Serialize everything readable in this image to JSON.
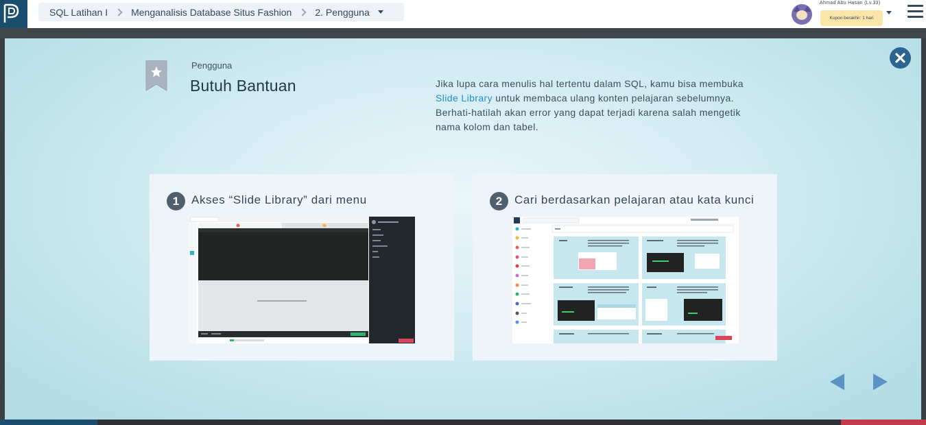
{
  "header": {
    "breadcrumb": [
      "SQL Latihan I",
      "Menganalisis Database Situs Fashion",
      "2. Pengguna"
    ],
    "user_name": "Ahmad Abu Hasan (Lv.33)",
    "coupon": "Kupon berakhir: 1 hari"
  },
  "slide": {
    "kicker": "Pengguna",
    "title": "Butuh Bantuan",
    "intro_before": "Jika lupa cara menulis hal tertentu dalam SQL, kamu bisa membuka ",
    "intro_link": "Slide Library",
    "intro_after": " untuk membaca ulang konten pelajaran sebelumnya. Berhati-hatilah akan error yang dapat terjadi karena salah mengetik nama kolom dan tabel.",
    "steps": [
      {
        "number": "1",
        "label": "Akses “Slide Library” dari menu"
      },
      {
        "number": "2",
        "label": "Cari berdasarkan pelajaran atau kata kunci"
      }
    ]
  },
  "colors": {
    "brand": "#1b4d6e",
    "link": "#1f8fd2",
    "close_button": "#2c6491",
    "nav_arrows": "#5b93c4"
  },
  "icons": {
    "logo": "progate-logo-icon",
    "bookmark": "star-bookmark-icon",
    "close": "close-icon",
    "menu": "hamburger-menu-icon",
    "prev": "prev-arrow-icon",
    "next": "next-arrow-icon"
  }
}
